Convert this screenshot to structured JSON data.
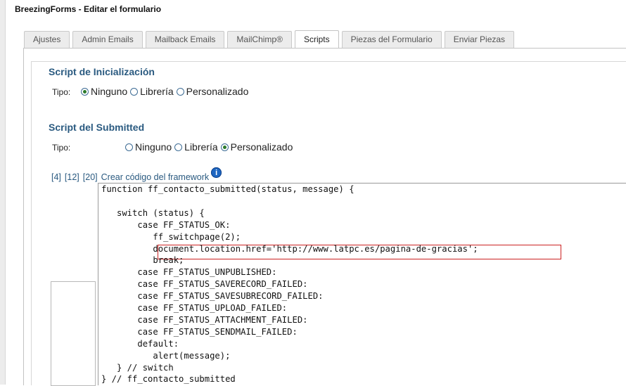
{
  "window": {
    "title": "BreezingForms - Editar el formulario"
  },
  "tabs": [
    {
      "label": "Ajustes",
      "active": false
    },
    {
      "label": "Admin Emails",
      "active": false
    },
    {
      "label": "Mailback Emails",
      "active": false
    },
    {
      "label": "MailChimp®",
      "active": false
    },
    {
      "label": "Scripts",
      "active": true
    },
    {
      "label": "Piezas del Formulario",
      "active": false
    },
    {
      "label": "Enviar Piezas",
      "active": false
    }
  ],
  "init_script": {
    "title": "Script de Inicialización",
    "type_label": "Tipo:",
    "options": [
      "Ninguno",
      "Librería",
      "Personalizado"
    ],
    "selected": "Ninguno"
  },
  "submitted_script": {
    "title": "Script del Submitted",
    "type_label": "Tipo:",
    "options": [
      "Ninguno",
      "Librería",
      "Personalizado"
    ],
    "selected": "Personalizado"
  },
  "framework": {
    "links": [
      "[4]",
      "[12]",
      "[20]",
      "Crear código del framework"
    ],
    "info_icon": "info-icon"
  },
  "code": {
    "lines": [
      "function ff_contacto_submitted(status, message) {",
      "",
      "   switch (status) {",
      "       case FF_STATUS_OK:",
      "          ff_switchpage(2);",
      "          document.location.href='http://www.latpc.es/pagina-de-gracias';",
      "          break;",
      "       case FF_STATUS_UNPUBLISHED:",
      "       case FF_STATUS_SAVERECORD_FAILED:",
      "       case FF_STATUS_SAVESUBRECORD_FAILED:",
      "       case FF_STATUS_UPLOAD_FAILED:",
      "       case FF_STATUS_ATTACHMENT_FAILED:",
      "       case FF_STATUS_SENDMAIL_FAILED:",
      "       default:",
      "          alert(message);",
      "   } // switch",
      "} // ff_contacto_submitted"
    ],
    "highlighted_line": 5
  },
  "colors": {
    "section_title": "#2a5a80",
    "link": "#2a5a80",
    "highlight_border": "#cc2222"
  }
}
